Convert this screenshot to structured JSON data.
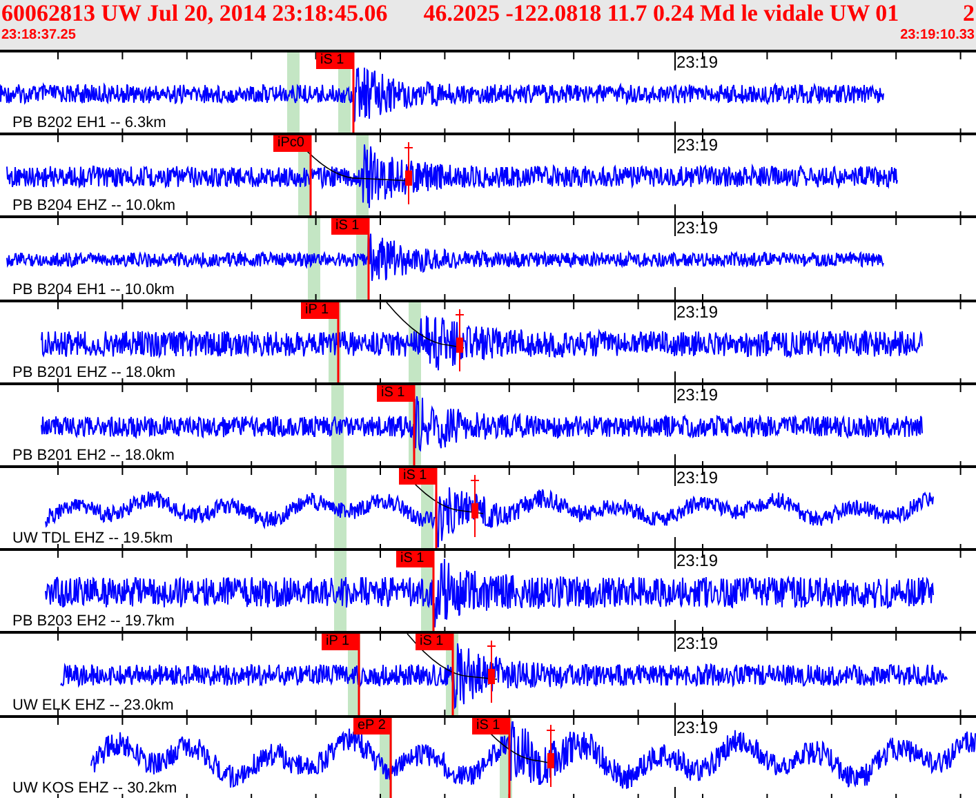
{
  "header": {
    "event": "60062813 UW Jul 20, 2014 23:18:45.06",
    "location": "46.2025 -122.0818 11.7 0.24 Md le vidale UW 01",
    "cut_off": "2",
    "start_time": "23:18:37.25",
    "end_time": "23:19:10.33"
  },
  "traces": [
    {
      "label": "PB B202 EH1 -- 6.3km",
      "time_mark": "23:19",
      "picks": [
        {
          "label": "iS 1"
        }
      ]
    },
    {
      "label": "PB B204 EHZ -- 10.0km",
      "time_mark": "23:19",
      "picks": [
        {
          "label": "iPc0"
        }
      ]
    },
    {
      "label": "PB B204 EH1 -- 10.0km",
      "time_mark": "23:19",
      "picks": [
        {
          "label": "iS 1"
        }
      ]
    },
    {
      "label": "PB B201 EHZ -- 18.0km",
      "time_mark": "23:19",
      "picks": [
        {
          "label": "iP 1"
        }
      ]
    },
    {
      "label": "PB B201 EH2 -- 18.0km",
      "time_mark": "23:19",
      "picks": [
        {
          "label": "iS 1"
        }
      ]
    },
    {
      "label": "UW TDL EHZ -- 19.5km",
      "time_mark": "23:19",
      "picks": [
        {
          "label": "iS 1"
        }
      ]
    },
    {
      "label": "PB B203 EH2 -- 19.7km",
      "time_mark": "23:19",
      "picks": [
        {
          "label": "iS 1"
        }
      ]
    },
    {
      "label": "UW ELK EHZ -- 23.0km",
      "time_mark": "23:19",
      "picks": [
        {
          "label": "iP 1"
        },
        {
          "label": "iS 1"
        }
      ]
    },
    {
      "label": "UW KOS EHZ -- 30.2km",
      "time_mark": "23:19",
      "picks": [
        {
          "label": "eP 2"
        },
        {
          "label": "iS 1"
        }
      ]
    }
  ]
}
